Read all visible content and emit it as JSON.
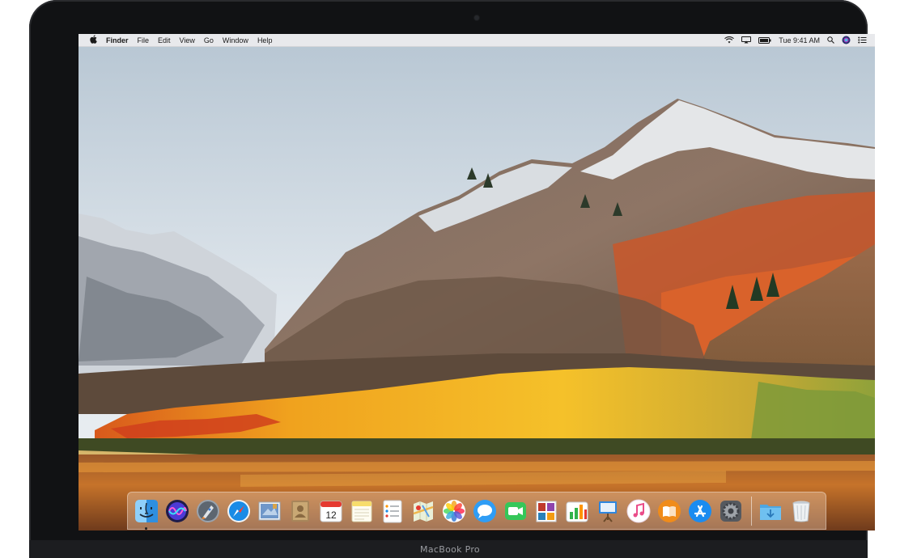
{
  "menubar": {
    "apple_icon": "apple-icon",
    "app_name": "Finder",
    "menus": [
      "File",
      "Edit",
      "View",
      "Go",
      "Window",
      "Help"
    ],
    "clock": "Tue 9:41 AM",
    "status_icons": [
      "wifi-icon",
      "airplay-icon",
      "battery-icon",
      "spotlight-icon",
      "siri-icon",
      "notification-center-icon"
    ]
  },
  "dock": {
    "apps": [
      {
        "name": "Finder",
        "icon": "finder-icon",
        "color": "#3aa0ee",
        "running": true
      },
      {
        "name": "Siri",
        "icon": "siri-icon",
        "color": "#5b3fd6"
      },
      {
        "name": "Launchpad",
        "icon": "launchpad-icon",
        "color": "#8a93a0"
      },
      {
        "name": "Safari",
        "icon": "safari-icon",
        "color": "#1a8be6"
      },
      {
        "name": "Mail",
        "icon": "mail-icon",
        "color": "#5d8fc7"
      },
      {
        "name": "Contacts",
        "icon": "contacts-icon",
        "color": "#a8865a"
      },
      {
        "name": "Calendar",
        "icon": "calendar-icon",
        "color": "#ffffff",
        "calendar_day": "12"
      },
      {
        "name": "Notes",
        "icon": "notes-icon",
        "color": "#f7dd6c"
      },
      {
        "name": "Reminders",
        "icon": "reminders-icon",
        "color": "#ffffff"
      },
      {
        "name": "Maps",
        "icon": "maps-icon",
        "color": "#7cc576"
      },
      {
        "name": "Photos",
        "icon": "photos-icon",
        "color": "#f5a623"
      },
      {
        "name": "Messages",
        "icon": "messages-icon",
        "color": "#2f9df5"
      },
      {
        "name": "FaceTime",
        "icon": "facetime-icon",
        "color": "#35c759"
      },
      {
        "name": "Photo Booth",
        "icon": "photo-booth-icon",
        "color": "#c0392b"
      },
      {
        "name": "Numbers",
        "icon": "numbers-icon",
        "color": "#32b34a"
      },
      {
        "name": "Keynote",
        "icon": "keynote-icon",
        "color": "#2e86de"
      },
      {
        "name": "iTunes",
        "icon": "itunes-icon",
        "color": "#ea4c89"
      },
      {
        "name": "iBooks",
        "icon": "ibooks-icon",
        "color": "#f08c1a"
      },
      {
        "name": "App Store",
        "icon": "app-store-icon",
        "color": "#1b8cf0"
      },
      {
        "name": "System Preferences",
        "icon": "system-preferences-icon",
        "color": "#6e7379"
      }
    ],
    "right": [
      {
        "name": "Downloads",
        "icon": "downloads-folder-icon",
        "color": "#5fb6ea"
      },
      {
        "name": "Trash",
        "icon": "trash-icon",
        "color": "#e8ecef"
      }
    ]
  },
  "device_label": "MacBook Pro"
}
